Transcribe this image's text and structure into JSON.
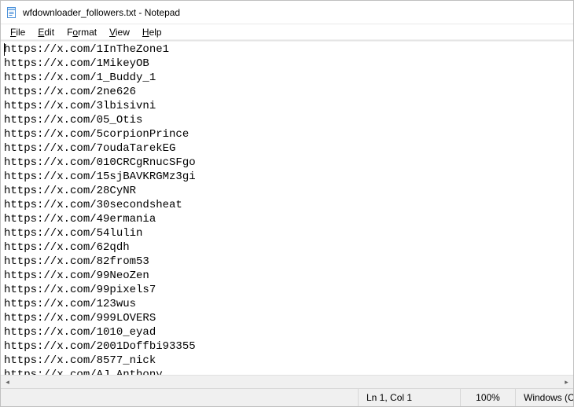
{
  "titlebar": {
    "title": "wfdownloader_followers.txt - Notepad"
  },
  "menu": {
    "file": "File",
    "edit": "Edit",
    "format": "Format",
    "view": "View",
    "help": "Help"
  },
  "content": {
    "lines": [
      "https://x.com/1InTheZone1",
      "https://x.com/1MikeyOB",
      "https://x.com/1_Buddy_1",
      "https://x.com/2ne626",
      "https://x.com/3lbisivni",
      "https://x.com/05_Otis",
      "https://x.com/5corpionPrince",
      "https://x.com/7oudaTarekEG",
      "https://x.com/010CRCgRnucSFgo",
      "https://x.com/15sjBAVKRGMz3gi",
      "https://x.com/28CyNR",
      "https://x.com/30secondsheat",
      "https://x.com/49ermania",
      "https://x.com/54lulin",
      "https://x.com/62qdh",
      "https://x.com/82from53",
      "https://x.com/99NeoZen",
      "https://x.com/99pixels7",
      "https://x.com/123wus",
      "https://x.com/999LOVERS",
      "https://x.com/1010_eyad",
      "https://x.com/2001Doffbi93355",
      "https://x.com/8577_nick",
      "https://x.com/AJ_Anthony"
    ]
  },
  "status": {
    "position": "Ln 1, Col 1",
    "zoom": "100%",
    "encoding": "Windows (CRLF)"
  }
}
